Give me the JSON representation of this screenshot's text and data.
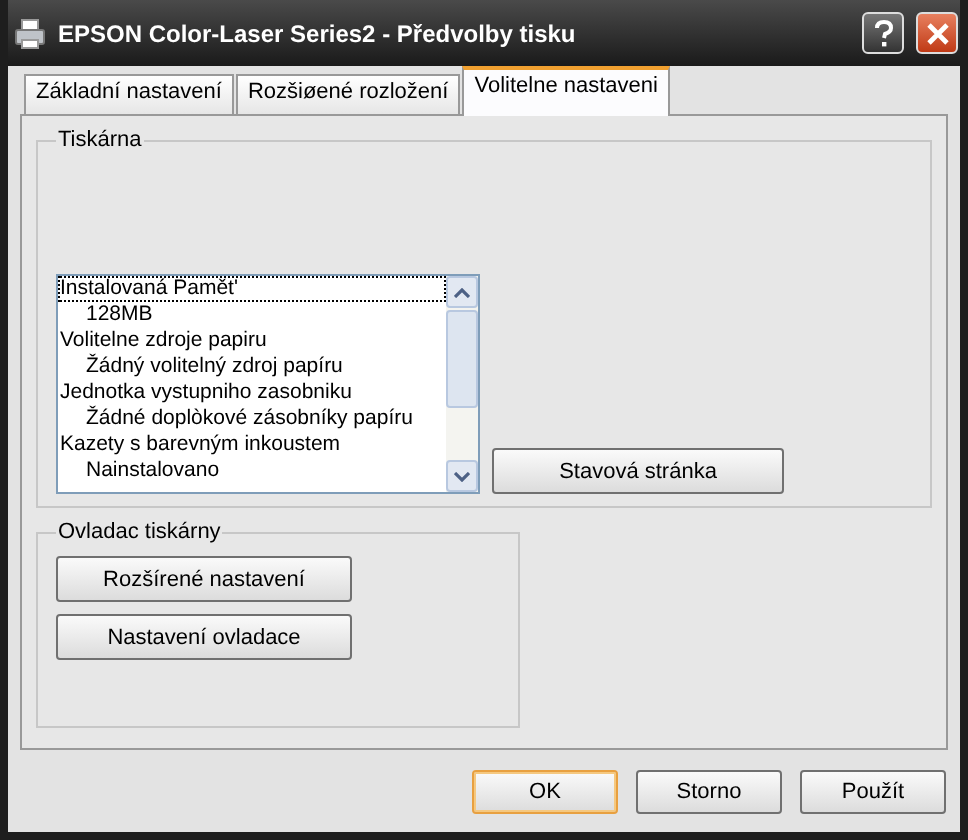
{
  "window": {
    "title": "EPSON Color-Laser Series2 - Předvolby tisku"
  },
  "tabs": [
    {
      "label": "Základní nastavení",
      "selected": false
    },
    {
      "label": "Rozšiøené rozložení",
      "selected": false
    },
    {
      "label": "Volitelne nastaveni",
      "selected": true
    }
  ],
  "printer_group": {
    "title": "Tiskárna",
    "options": [
      {
        "label": "Instalovaná Pamět'",
        "selected": true,
        "children": [
          {
            "label": "128MB",
            "selected": false
          }
        ]
      },
      {
        "label": "Volitelne zdroje papiru",
        "selected": false,
        "children": [
          {
            "label": "Žádný volitelný zdroj papíru",
            "selected": false
          }
        ]
      },
      {
        "label": "Jednotka vystupniho zasobniku",
        "selected": false,
        "children": [
          {
            "label": "Žádné doplòkové zásobníky papíru",
            "selected": false
          }
        ]
      },
      {
        "label": "Kazety s barevným inkoustem",
        "selected": false,
        "children": [
          {
            "label": "Nainstalovano",
            "selected": false
          }
        ]
      }
    ],
    "status_button": "Stavová stránka"
  },
  "driver_group": {
    "title": "Ovladac tiskárny",
    "buttons": [
      "Rozšírené nastavení",
      "Nastavení ovladace"
    ]
  },
  "buttons": [
    {
      "label": "OK",
      "default": true
    },
    {
      "label": "Storno",
      "default": false
    },
    {
      "label": "Použít",
      "default": false
    }
  ]
}
